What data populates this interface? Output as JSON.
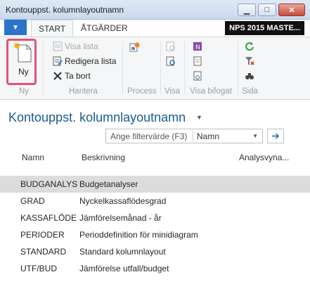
{
  "window": {
    "title": "Kontouppst. kolumnlayoutnamn",
    "minimize_icon": "minimize-icon",
    "maximize_icon": "maximize-icon",
    "close_icon": "close-icon"
  },
  "ribbon_tabs": {
    "start": "START",
    "atgarder": "ÅTGÄRDER",
    "company": "NPS 2015 MASTE..."
  },
  "ribbon": {
    "ny_label": "Ny",
    "group_ny": "Ny",
    "visa_lista": "Visa lista",
    "redigera_lista": "Redigera lista",
    "ta_bort": "Ta bort",
    "group_hantera": "Hantera",
    "group_process": "Process",
    "group_visa": "Visa",
    "group_visa_bifogat": "Visa bifogat",
    "group_sida": "Sida"
  },
  "page": {
    "title": "Kontouppst. kolumnlayoutnamn"
  },
  "filter": {
    "placeholder": "Ange filtervärde (F3)",
    "field": "Namn"
  },
  "table": {
    "headers": [
      "Namn",
      "Beskrivning",
      "Analysvyna..."
    ],
    "rows": [
      {
        "namn": "BUDGANALYS",
        "beskrivning": "Budgetanalyser"
      },
      {
        "namn": "GRAD",
        "beskrivning": "Nyckelkassaflödesgrad"
      },
      {
        "namn": "KASSAFLÖDE",
        "beskrivning": "Jämförelsemånad - år"
      },
      {
        "namn": "PERIODER",
        "beskrivning": "Perioddefinition för minidiagram"
      },
      {
        "namn": "STANDARD",
        "beskrivning": "Standard kolumnlayout"
      },
      {
        "namn": "UTF/BUD",
        "beskrivning": "Jämförelse utfall/budget"
      }
    ]
  },
  "colors": {
    "accent": "#1a5d8f",
    "highlight_border": "#e0537c",
    "selected_row": "#dcdcdc"
  }
}
